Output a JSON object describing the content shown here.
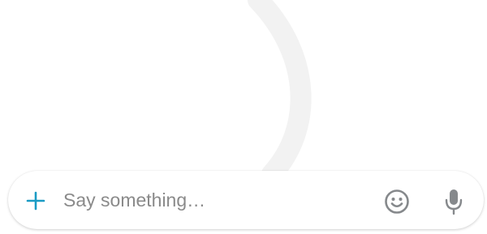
{
  "composer": {
    "add_icon": "plus-icon",
    "input_value": "",
    "input_placeholder": "Say something…",
    "emoji_icon": "smiley-icon",
    "mic_icon": "microphone-icon"
  },
  "colors": {
    "accent": "#1a9bc4",
    "icon_gray": "#86898c",
    "placeholder": "#8a8a8a"
  }
}
